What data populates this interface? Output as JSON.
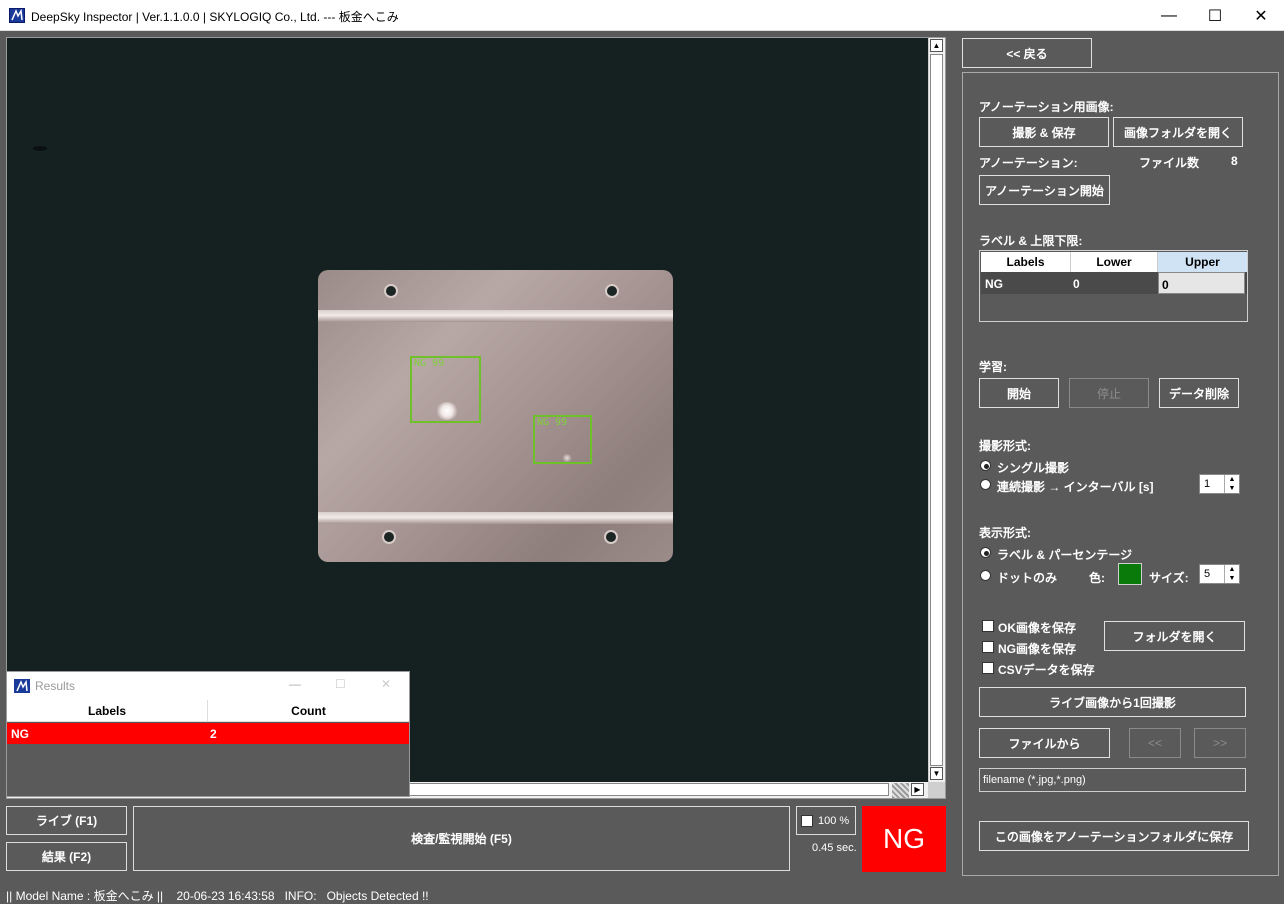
{
  "window": {
    "title": "DeepSky Inspector | Ver.1.1.0.0 | SKYLOGIQ Co., Ltd. --- 板金へこみ",
    "minimize": "—",
    "maximize": "☐",
    "close": "✕"
  },
  "viewer": {
    "detections": [
      {
        "label": "NG 99"
      },
      {
        "label": "NG 99"
      }
    ]
  },
  "results_window": {
    "title": "Results",
    "columns": [
      "Labels",
      "Count"
    ],
    "rows": [
      {
        "label": "NG",
        "count": "2"
      }
    ]
  },
  "bottom": {
    "live_button": "ライブ (F1)",
    "result_button": "結果 (F2)",
    "inspect_button": "検査/監視開始 (F5)",
    "zoom_label": "100 %",
    "elapsed": "0.45 sec.",
    "verdict": "NG",
    "verdict_color": "#ff0000"
  },
  "right_panel": {
    "back_button": "<< 戻る",
    "annotation_image_title": "アノーテーション用画像:",
    "capture_save_button": "撮影 & 保存",
    "open_image_folder_button": "画像フォルダを開く",
    "annotation_title": "アノーテーション:",
    "file_count_label": "ファイル数",
    "file_count_value": "8",
    "start_annotation_button": "アノーテーション開始",
    "label_limits_title": "ラベル & 上限下限:",
    "label_table": {
      "columns": [
        "Labels",
        "Lower",
        "Upper"
      ],
      "rows": [
        {
          "label": "NG",
          "lower": "0",
          "upper": "0"
        }
      ]
    },
    "learning_title": "学習:",
    "start_button": "開始",
    "stop_button": "停止",
    "delete_data_button": "データ削除",
    "capture_mode_title": "撮影形式:",
    "single_capture": "シングル撮影",
    "continuous_capture": "連続撮影 → インターバル [s]",
    "interval_value": "1",
    "display_mode_title": "表示形式:",
    "label_percentage": "ラベル & パーセンテージ",
    "dot_only": "ドットのみ",
    "color_label": "色:",
    "dot_color": "#0a7a0a",
    "size_label": "サイズ:",
    "size_value": "5",
    "save_ok": "OK画像を保存",
    "save_ng": "NG画像を保存",
    "save_csv": "CSVデータを保存",
    "open_folder_button": "フォルダを開く",
    "capture_once_button": "ライブ画像から1回撮影",
    "from_file_button": "ファイルから",
    "prev_button": "<<",
    "next_button": ">>",
    "filename_placeholder": "filename (*.jpg,*.png)",
    "save_to_annotation_button": "この画像をアノーテーションフォルダに保存"
  },
  "status_bar": {
    "text": "|| Model Name : 板金へこみ ||    20-06-23 16:43:58   INFO:   Objects Detected !!"
  }
}
